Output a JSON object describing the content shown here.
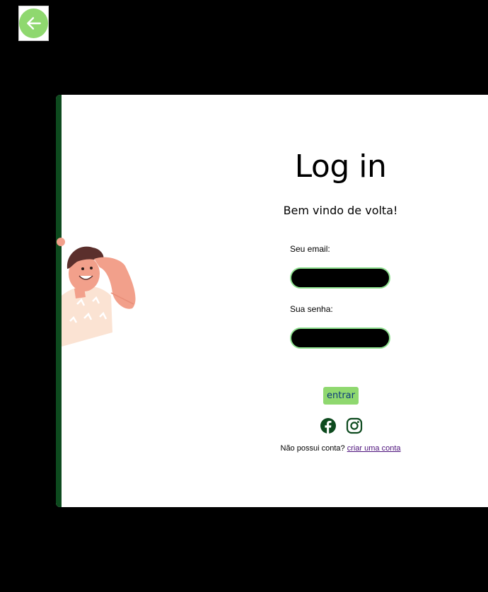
{
  "back_button": {
    "icon": "arrow-left-icon"
  },
  "login": {
    "title": "Log in",
    "subtitle": "Bem vindo de volta!",
    "email_label": "Seu email:",
    "email_value": "",
    "password_label": "Sua senha:",
    "password_value": "",
    "submit_label": "entrar"
  },
  "social": [
    {
      "icon": "facebook-icon"
    },
    {
      "icon": "instagram-icon"
    }
  ],
  "signup": {
    "prompt": "Não possui conta?",
    "link_label": "criar uma conta"
  },
  "colors": {
    "accent_green": "#8fd86f",
    "dark_green": "#0d4a1e",
    "input_border": "#8ee08f",
    "link": "#4b0f7a"
  }
}
